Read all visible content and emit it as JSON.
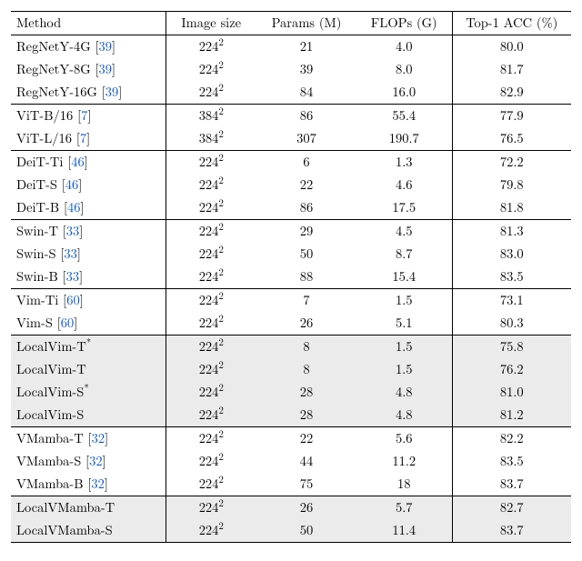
{
  "chart_data": {
    "type": "table",
    "title": "",
    "columns": [
      "Method",
      "Image size",
      "Params (M)",
      "FLOPs (G)",
      "Top-1 ACC (%)"
    ],
    "groups": [
      {
        "highlight": false,
        "rows": [
          {
            "method": "RegNetY-4G",
            "ref": "39",
            "star": false,
            "img_base": "224",
            "params": "21",
            "flops": "4.0",
            "acc": "80.0"
          },
          {
            "method": "RegNetY-8G",
            "ref": "39",
            "star": false,
            "img_base": "224",
            "params": "39",
            "flops": "8.0",
            "acc": "81.7"
          },
          {
            "method": "RegNetY-16G",
            "ref": "39",
            "star": false,
            "img_base": "224",
            "params": "84",
            "flops": "16.0",
            "acc": "82.9"
          }
        ]
      },
      {
        "highlight": false,
        "rows": [
          {
            "method": "ViT-B/16",
            "ref": "7",
            "star": false,
            "img_base": "384",
            "params": "86",
            "flops": "55.4",
            "acc": "77.9"
          },
          {
            "method": "ViT-L/16",
            "ref": "7",
            "star": false,
            "img_base": "384",
            "params": "307",
            "flops": "190.7",
            "acc": "76.5"
          }
        ]
      },
      {
        "highlight": false,
        "rows": [
          {
            "method": "DeiT-Ti",
            "ref": "46",
            "star": false,
            "img_base": "224",
            "params": "6",
            "flops": "1.3",
            "acc": "72.2"
          },
          {
            "method": "DeiT-S",
            "ref": "46",
            "star": false,
            "img_base": "224",
            "params": "22",
            "flops": "4.6",
            "acc": "79.8"
          },
          {
            "method": "DeiT-B",
            "ref": "46",
            "star": false,
            "img_base": "224",
            "params": "86",
            "flops": "17.5",
            "acc": "81.8"
          }
        ]
      },
      {
        "highlight": false,
        "rows": [
          {
            "method": "Swin-T",
            "ref": "33",
            "star": false,
            "img_base": "224",
            "params": "29",
            "flops": "4.5",
            "acc": "81.3"
          },
          {
            "method": "Swin-S",
            "ref": "33",
            "star": false,
            "img_base": "224",
            "params": "50",
            "flops": "8.7",
            "acc": "83.0"
          },
          {
            "method": "Swin-B",
            "ref": "33",
            "star": false,
            "img_base": "224",
            "params": "88",
            "flops": "15.4",
            "acc": "83.5"
          }
        ]
      },
      {
        "highlight": false,
        "rows": [
          {
            "method": "Vim-Ti",
            "ref": "60",
            "star": false,
            "img_base": "224",
            "params": "7",
            "flops": "1.5",
            "acc": "73.1"
          },
          {
            "method": "Vim-S",
            "ref": "60",
            "star": false,
            "img_base": "224",
            "params": "26",
            "flops": "5.1",
            "acc": "80.3"
          }
        ]
      },
      {
        "highlight": true,
        "rows": [
          {
            "method": "LocalVim-T",
            "ref": null,
            "star": true,
            "img_base": "224",
            "params": "8",
            "flops": "1.5",
            "acc": "75.8"
          },
          {
            "method": "LocalVim-T",
            "ref": null,
            "star": false,
            "img_base": "224",
            "params": "8",
            "flops": "1.5",
            "acc": "76.2"
          },
          {
            "method": "LocalVim-S",
            "ref": null,
            "star": true,
            "img_base": "224",
            "params": "28",
            "flops": "4.8",
            "acc": "81.0"
          },
          {
            "method": "LocalVim-S",
            "ref": null,
            "star": false,
            "img_base": "224",
            "params": "28",
            "flops": "4.8",
            "acc": "81.2"
          }
        ]
      },
      {
        "highlight": false,
        "rows": [
          {
            "method": "VMamba-T",
            "ref": "32",
            "star": false,
            "img_base": "224",
            "params": "22",
            "flops": "5.6",
            "acc": "82.2"
          },
          {
            "method": "VMamba-S",
            "ref": "32",
            "star": false,
            "img_base": "224",
            "params": "44",
            "flops": "11.2",
            "acc": "83.5"
          },
          {
            "method": "VMamba-B",
            "ref": "32",
            "star": false,
            "img_base": "224",
            "params": "75",
            "flops": "18",
            "acc": "83.7"
          }
        ]
      },
      {
        "highlight": true,
        "rows": [
          {
            "method": "LocalVMamba-T",
            "ref": null,
            "star": false,
            "img_base": "224",
            "params": "26",
            "flops": "5.7",
            "acc": "82.7"
          },
          {
            "method": "LocalVMamba-S",
            "ref": null,
            "star": false,
            "img_base": "224",
            "params": "50",
            "flops": "11.4",
            "acc": "83.7"
          }
        ]
      }
    ]
  },
  "header": {
    "method": "Method",
    "img": "Image size",
    "params": "Params (M)",
    "flops": "FLOPs (G)",
    "acc": "Top-1 ACC (%)"
  }
}
